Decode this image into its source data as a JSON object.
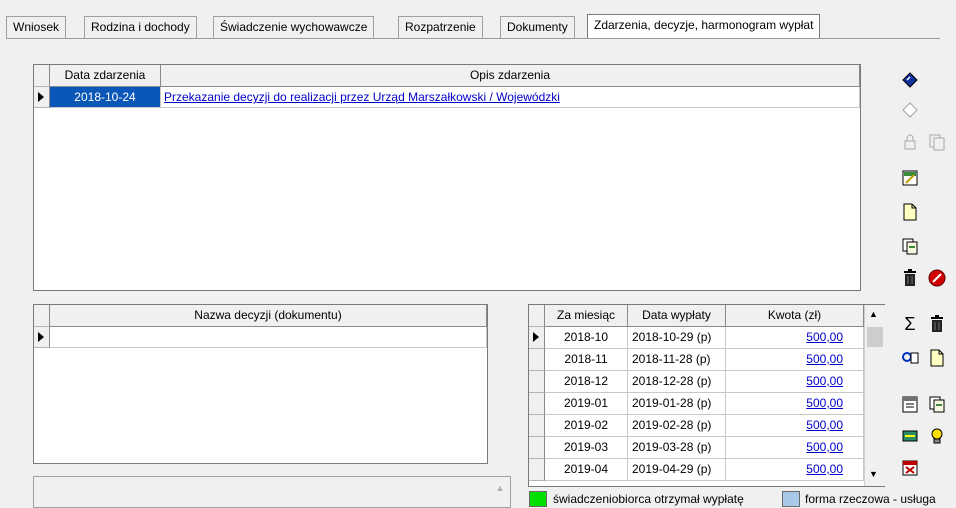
{
  "tabs": [
    {
      "label": "Wniosek"
    },
    {
      "label": "Rodzina i dochody"
    },
    {
      "label": "Świadczenie wychowawcze"
    },
    {
      "label": "Rozpatrzenie"
    },
    {
      "label": "Dokumenty"
    },
    {
      "label": "Zdarzenia, decyzje, harmonogram wypłat"
    }
  ],
  "events": {
    "columns": {
      "date": "Data zdarzenia",
      "description": "Opis zdarzenia"
    },
    "rows": [
      {
        "date": "2018-10-24",
        "description": "Przekazanie decyzji do realizacji przez Urząd Marszałkowski / Wojewódzki"
      }
    ]
  },
  "decisions": {
    "column": "Nazwa decyzji (dokumentu)",
    "rows": [
      {
        "name": ""
      }
    ]
  },
  "schedule": {
    "columns": {
      "month": "Za miesiąc",
      "pay_date": "Data wypłaty",
      "amount": "Kwota (zł)"
    },
    "rows": [
      {
        "month": "2018-10",
        "pay_date": "2018-10-29 (p)",
        "amount": "500,00"
      },
      {
        "month": "2018-11",
        "pay_date": "2018-11-28 (p)",
        "amount": "500,00"
      },
      {
        "month": "2018-12",
        "pay_date": "2018-12-28 (p)",
        "amount": "500,00"
      },
      {
        "month": "2019-01",
        "pay_date": "2019-01-28 (p)",
        "amount": "500,00"
      },
      {
        "month": "2019-02",
        "pay_date": "2019-02-28 (p)",
        "amount": "500,00"
      },
      {
        "month": "2019-03",
        "pay_date": "2019-03-28 (p)",
        "amount": "500,00"
      },
      {
        "month": "2019-04",
        "pay_date": "2019-04-29 (p)",
        "amount": "500,00"
      }
    ]
  },
  "legend": {
    "received": {
      "label": "świadczeniobiorca otrzymał wypłatę",
      "color": "#00e000"
    },
    "in_kind": {
      "label": "forma rzeczowa - usługa",
      "color": "#a8c8e8"
    }
  },
  "icons": {
    "scroll_up": "▲",
    "scroll_down": "▼",
    "sum": "Σ",
    "row_marker": "▶"
  },
  "colors": {
    "selection": "#0a57b8",
    "link": "#0000cc"
  }
}
